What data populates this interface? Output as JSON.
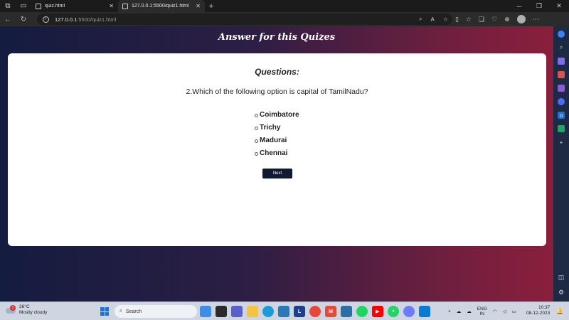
{
  "browser": {
    "tabs": [
      {
        "title": "quiz.html",
        "active": false
      },
      {
        "title": "127.0.0.1:5500/quiz1.html",
        "active": true
      }
    ],
    "url_host": "127.0.0.1",
    "url_rest": ":5500/quiz1.html"
  },
  "page": {
    "title": "Answer for this Quizes",
    "question_heading": "Questions:",
    "question_text": "2.Which of the following option is capital of TamilNadu?",
    "options": [
      "Coimbatore",
      "Trichy",
      "Madurai",
      "Chennai"
    ],
    "next_label": "Next",
    "colors": {
      "gradient_start": "#141c3f",
      "gradient_end": "#8a1f3c",
      "button": "#0f1b33"
    }
  },
  "taskbar": {
    "weather_temp": "26°C",
    "weather_desc": "Mostly cloudy",
    "weather_badge": "1",
    "search_placeholder": "Search",
    "lang_top": "ENG",
    "lang_bottom": "IN",
    "time": "10:37",
    "date": "08-12-2023",
    "whatsapp_badge": "4"
  }
}
